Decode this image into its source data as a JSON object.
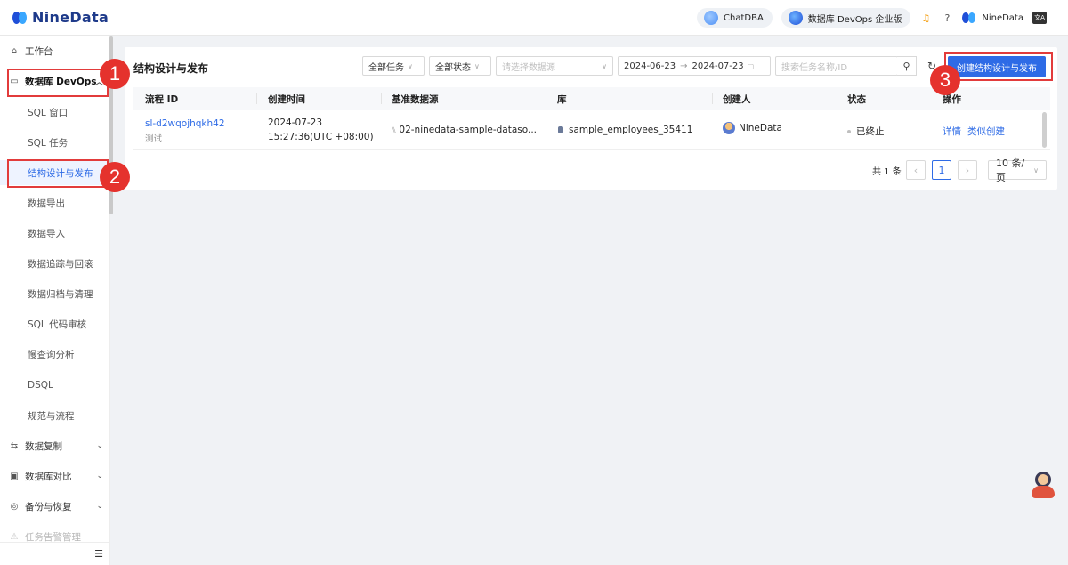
{
  "header": {
    "brand": "NineData",
    "chatdba": "ChatDBA",
    "edition": "数据库 DevOps 企业版",
    "user": "NineData",
    "lang_icon": "translate-icon"
  },
  "sidebar": {
    "workbench": "工作台",
    "devops_group": "数据库 DevOps",
    "items": [
      "SQL 窗口",
      "SQL 任务",
      "结构设计与发布",
      "数据导出",
      "数据导入",
      "数据追踪与回滚",
      "数据归档与清理",
      "SQL 代码审核",
      "慢查询分析",
      "DSQL",
      "规范与流程"
    ],
    "groups": [
      "数据复制",
      "数据库对比",
      "备份与恢复",
      "任务告警管理"
    ]
  },
  "annotations": [
    "1",
    "2",
    "3"
  ],
  "page": {
    "title": "结构设计与发布",
    "filter_task": "全部任务",
    "filter_status": "全部状态",
    "filter_datasource_placeholder": "请选择数据源",
    "date_start": "2024-06-23",
    "date_arrow": "→",
    "date_end": "2024-07-23",
    "search_placeholder": "搜索任务名称/ID",
    "create_button": "创建结构设计与发布"
  },
  "table": {
    "columns": [
      "流程 ID",
      "创建时间",
      "基准数据源",
      "库",
      "创建人",
      "状态",
      "操作"
    ],
    "rows": [
      {
        "id": "sl-d2wqojhqkh42",
        "name": "测试",
        "created_date": "2024-07-23",
        "created_time": "15:27:36(UTC +08:00)",
        "datasource": "02-ninedata-sample-dataso...",
        "database": "sample_employees_35411",
        "creator": "NineData",
        "status": "已终止",
        "action_detail": "详情",
        "action_clone": "类似创建"
      }
    ]
  },
  "pagination": {
    "total": "共 1 条",
    "current": "1",
    "page_size": "10 条/页"
  },
  "colors": {
    "accent": "#2e6be6",
    "annotation_red": "#e5322d"
  }
}
